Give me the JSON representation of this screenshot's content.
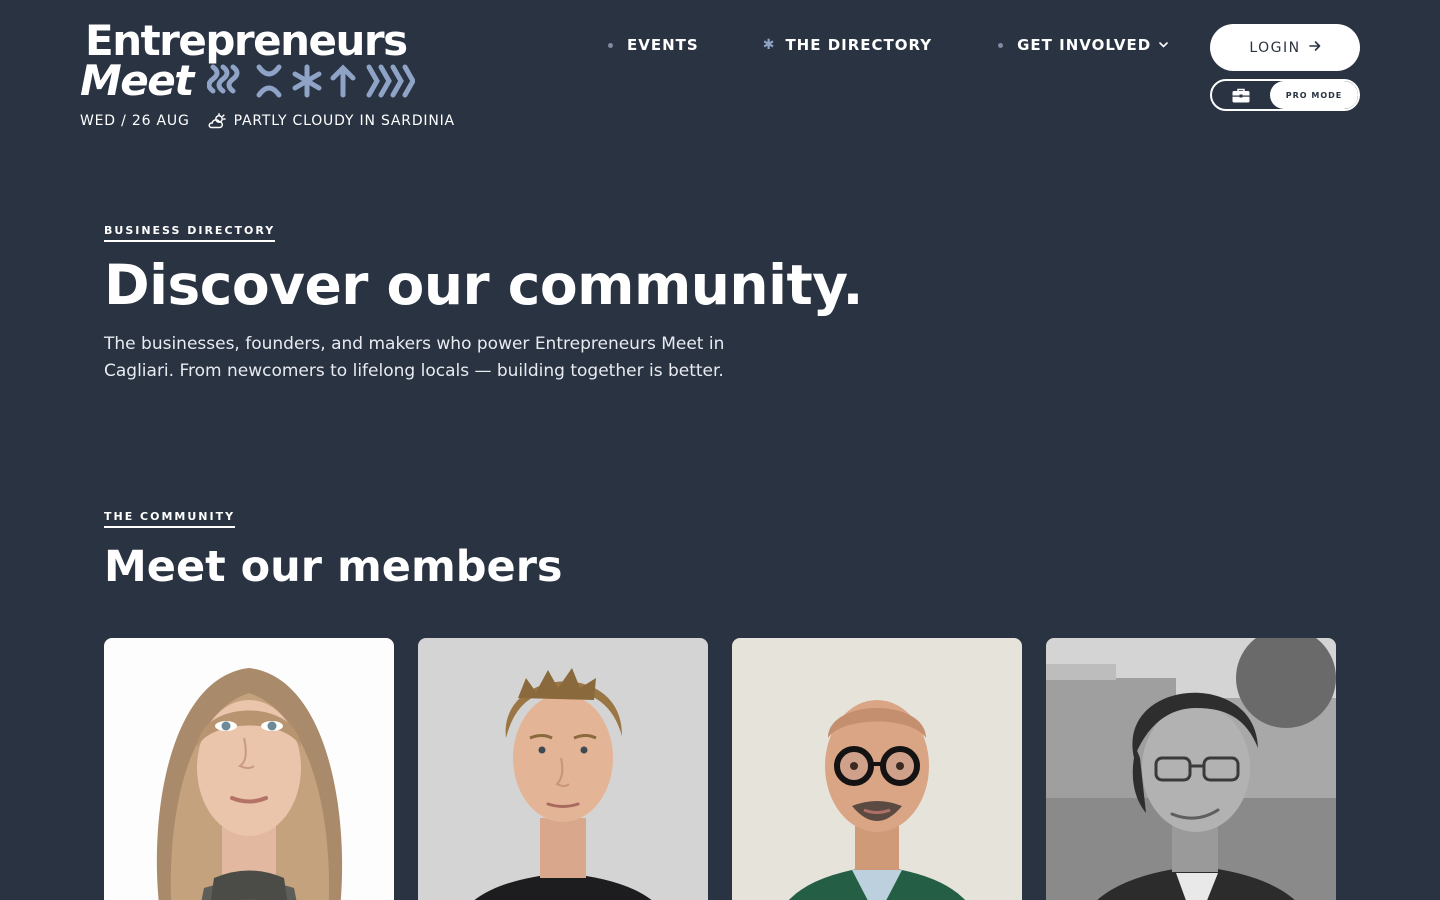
{
  "brand": {
    "line1": "Entrepreneurs",
    "line2": "Meet"
  },
  "meta": {
    "date": "WED / 26 AUG",
    "weather": "PARTLY CLOUDY IN SARDINIA",
    "weather_icon": "partly-cloudy-icon"
  },
  "nav": {
    "events": "EVENTS",
    "directory": "THE DIRECTORY",
    "get_involved": "GET INVOLVED"
  },
  "login": {
    "label": "LOGIN",
    "icon": "arrow-right-icon"
  },
  "pro_mode": {
    "label": "PRO MODE",
    "icon": "briefcase-icon"
  },
  "hero": {
    "eyebrow": "BUSINESS DIRECTORY",
    "title": "Discover our community.",
    "description": "The businesses, founders, and makers who power Entrepreneurs Meet in Cagliari. From newcomers to lifelong locals — building together is better."
  },
  "members": {
    "eyebrow": "THE COMMUNITY",
    "title": "Meet our members"
  },
  "colors": {
    "background": "#2a3342",
    "text": "#ffffff",
    "accent_glyphs": "#8fa3c6"
  }
}
